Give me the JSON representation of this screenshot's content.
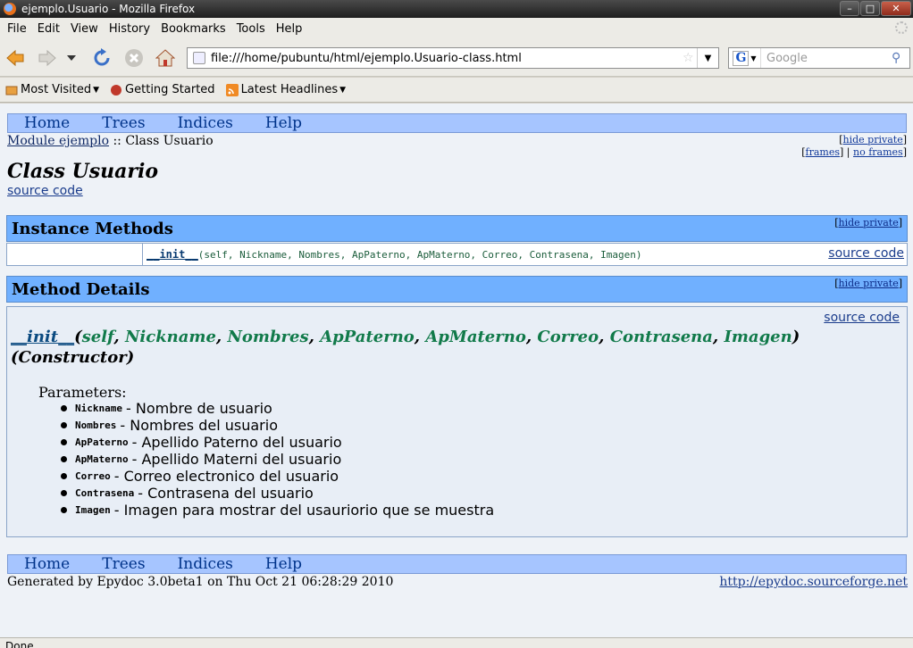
{
  "window": {
    "title": "ejemplo.Usuario - Mozilla Firefox"
  },
  "menubar": {
    "items": [
      "File",
      "Edit",
      "View",
      "History",
      "Bookmarks",
      "Tools",
      "Help"
    ]
  },
  "navbar": {
    "url": "file:///home/pubuntu/html/ejemplo.Usuario-class.html",
    "search_placeholder": "Google"
  },
  "bookmarks": {
    "items": [
      "Most Visited",
      "Getting Started",
      "Latest Headlines"
    ]
  },
  "page": {
    "nav_links": [
      "Home",
      "Trees",
      "Indices",
      "Help"
    ],
    "breadcrumb": {
      "module_link": "Module ejemplo",
      "separator": "::",
      "current": "Class Usuario"
    },
    "right_links": {
      "open": "[",
      "hide_private": "hide private",
      "close": "]",
      "frames": "frames",
      "divider": "|",
      "no_frames": "no frames"
    },
    "class_title": "Class Usuario",
    "source_code": "source code",
    "instance_methods": {
      "heading": "Instance Methods",
      "method_name": "__init__",
      "method_signature": "(self, Nickname, Nombres, ApPaterno, ApMaterno, Correo, Contrasena, Imagen)"
    },
    "method_details": {
      "heading": "Method Details",
      "fn_name": "__init__",
      "args": [
        "self",
        "Nickname",
        "Nombres",
        "ApPaterno",
        "ApMaterno",
        "Correo",
        "Contrasena",
        "Imagen"
      ],
      "constructor_label": "(Constructor)",
      "params_label": "Parameters:",
      "params": [
        {
          "name": "Nickname",
          "desc": "- Nombre de usuario"
        },
        {
          "name": "Nombres",
          "desc": "- Nombres del usuario"
        },
        {
          "name": "ApPaterno",
          "desc": "- Apellido Paterno del usuario"
        },
        {
          "name": "ApMaterno",
          "desc": "- Apellido Materni del usuario"
        },
        {
          "name": "Correo",
          "desc": "- Correo electronico del usuario"
        },
        {
          "name": "Contrasena",
          "desc": "- Contrasena del usuario"
        },
        {
          "name": "Imagen",
          "desc": "- Imagen para mostrar del usauriorio que se muestra"
        }
      ]
    },
    "footer": {
      "generated": "Generated by Epydoc 3.0beta1 on Thu Oct 21 06:28:29 2010",
      "link": "http://epydoc.sourceforge.net"
    }
  },
  "status": "Done",
  "colors": {
    "nav_strip": "#a6c5ff",
    "section_head": "#70b0ff",
    "content_bg": "#eef2f7",
    "arg_green": "#117a4a"
  }
}
